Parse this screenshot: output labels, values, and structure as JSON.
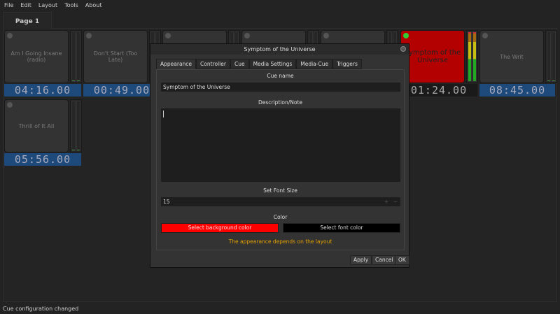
{
  "menu": [
    "File",
    "Edit",
    "Layout",
    "Tools",
    "About"
  ],
  "page_tab": "Page 1",
  "cues": [
    {
      "title": "Am I Going Insane (radio)",
      "time": "04:16.00"
    },
    {
      "title": "Don't Start (Too Late)",
      "time": "00:49.00"
    },
    {
      "title": "Symptom of the Universe",
      "time": "01:24.00",
      "active": true,
      "color": "#b30000"
    },
    {
      "title": "The Writ",
      "time": "08:45.00"
    },
    {
      "title": "Thrill of It All",
      "time": "05:56.00"
    }
  ],
  "dialog": {
    "title": "Symptom of the Universe",
    "tabs": [
      "Appearance",
      "Controller",
      "Cue",
      "Media Settings",
      "Media-Cue",
      "Triggers"
    ],
    "cue_name_label": "Cue name",
    "cue_name_value": "Symptom of the Universe",
    "description_label": "Description/Note",
    "description_value": "",
    "font_size_label": "Set Font Size",
    "font_size_value": "15",
    "plus": "+",
    "minus": "−",
    "color_label": "Color",
    "bg_color_button": "Select background color",
    "font_color_button": "Select font color",
    "note": "The appearance depends on the layout",
    "apply": "Apply",
    "cancel": "Cancel",
    "ok": "OK"
  },
  "status": "Cue configuration changed"
}
